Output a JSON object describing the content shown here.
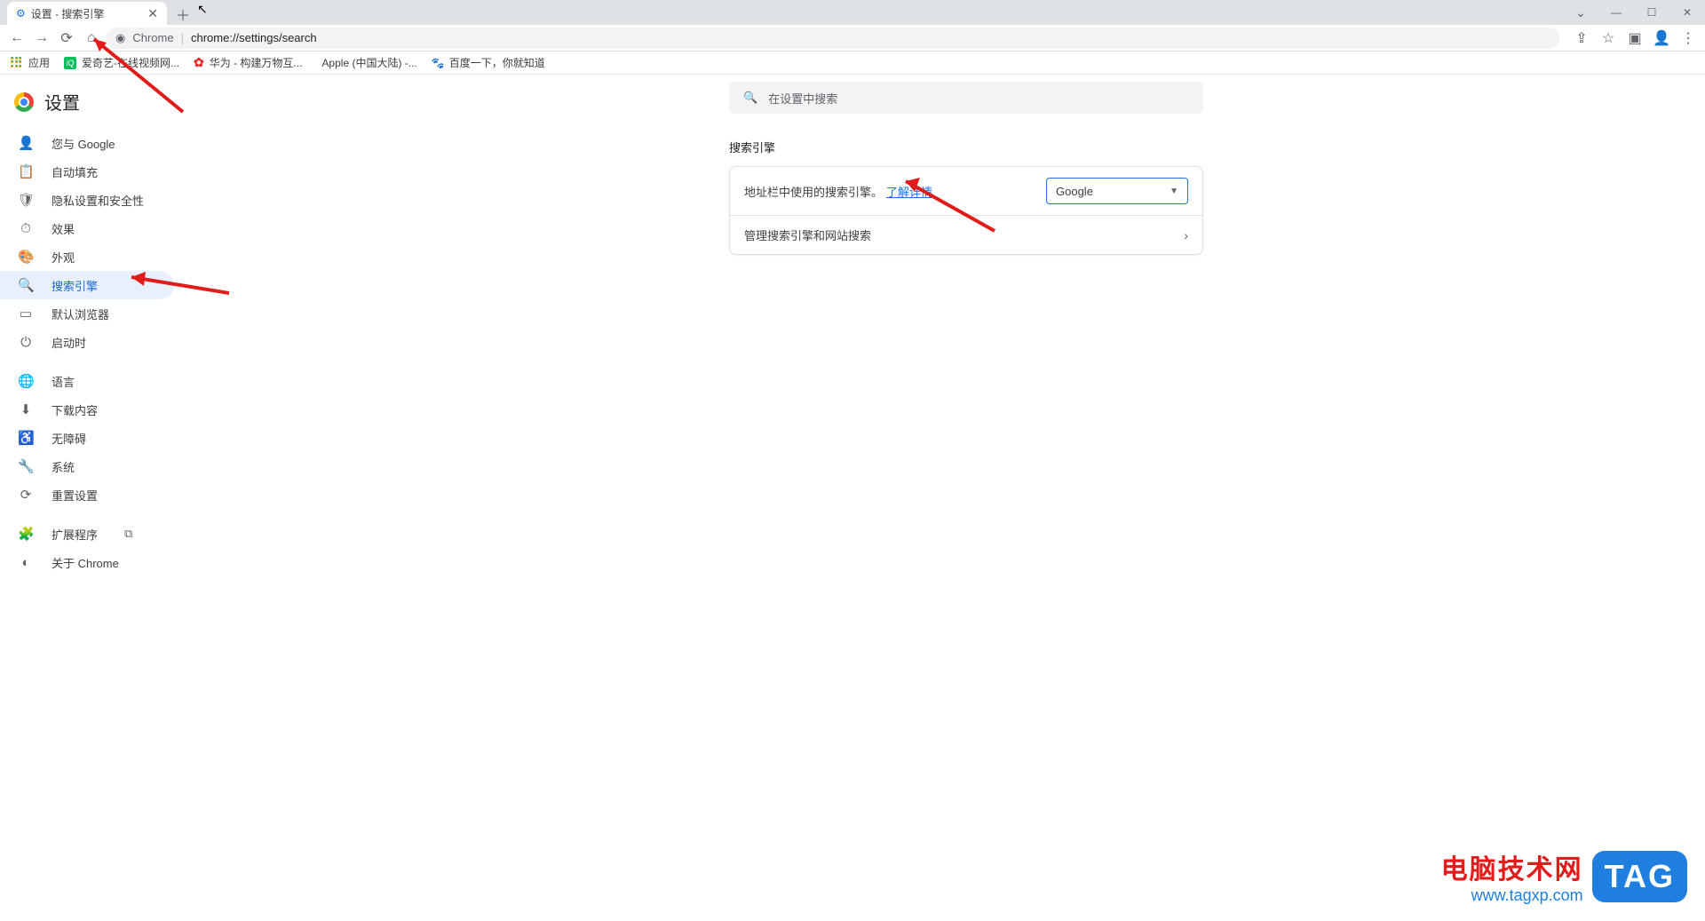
{
  "tab": {
    "title": "设置 - 搜索引擎"
  },
  "toolbar": {
    "chrome_label": "Chrome",
    "divider": "|",
    "url": "chrome://settings/search"
  },
  "bookmarks": {
    "apps": "应用",
    "items": [
      {
        "label": "爱奇艺-在线视频网..."
      },
      {
        "label": "华为 - 构建万物互..."
      },
      {
        "label": "Apple (中国大陆) -..."
      },
      {
        "label": "百度一下，你就知道"
      }
    ]
  },
  "page": {
    "title": "设置"
  },
  "sidebar": {
    "group1": [
      {
        "icon": "👤",
        "label": "您与 Google",
        "name": "sidebar-item-you-and-google"
      },
      {
        "icon": "📋",
        "label": "自动填充",
        "name": "sidebar-item-autofill"
      },
      {
        "icon": "🛡",
        "label": "隐私设置和安全性",
        "name": "sidebar-item-privacy"
      },
      {
        "icon": "⏱",
        "label": "效果",
        "name": "sidebar-item-performance"
      },
      {
        "icon": "🎨",
        "label": "外观",
        "name": "sidebar-item-appearance"
      },
      {
        "icon": "🔍",
        "label": "搜索引擎",
        "name": "sidebar-item-search-engine",
        "selected": true
      },
      {
        "icon": "▭",
        "label": "默认浏览器",
        "name": "sidebar-item-default-browser"
      },
      {
        "icon": "⏻",
        "label": "启动时",
        "name": "sidebar-item-on-startup"
      }
    ],
    "group2": [
      {
        "icon": "🌐",
        "label": "语言",
        "name": "sidebar-item-language"
      },
      {
        "icon": "⬇",
        "label": "下载内容",
        "name": "sidebar-item-downloads"
      },
      {
        "icon": "♿",
        "label": "无障碍",
        "name": "sidebar-item-accessibility"
      },
      {
        "icon": "🔧",
        "label": "系统",
        "name": "sidebar-item-system"
      },
      {
        "icon": "⟳",
        "label": "重置设置",
        "name": "sidebar-item-reset"
      }
    ],
    "group3": [
      {
        "icon": "🧩",
        "label": "扩展程序",
        "name": "sidebar-item-extensions",
        "ext": true
      },
      {
        "icon": "◐",
        "label": "关于 Chrome",
        "name": "sidebar-item-about"
      }
    ]
  },
  "search": {
    "placeholder": "在设置中搜索"
  },
  "section": {
    "title": "搜索引擎",
    "row1_text": "地址栏中使用的搜索引擎。",
    "row1_link": "了解详情",
    "select_value": "Google",
    "row2_text": "管理搜索引擎和网站搜索"
  },
  "watermark": {
    "line1": "电脑技术网",
    "line2": "www.tagxp.com",
    "tag": "TAG"
  }
}
